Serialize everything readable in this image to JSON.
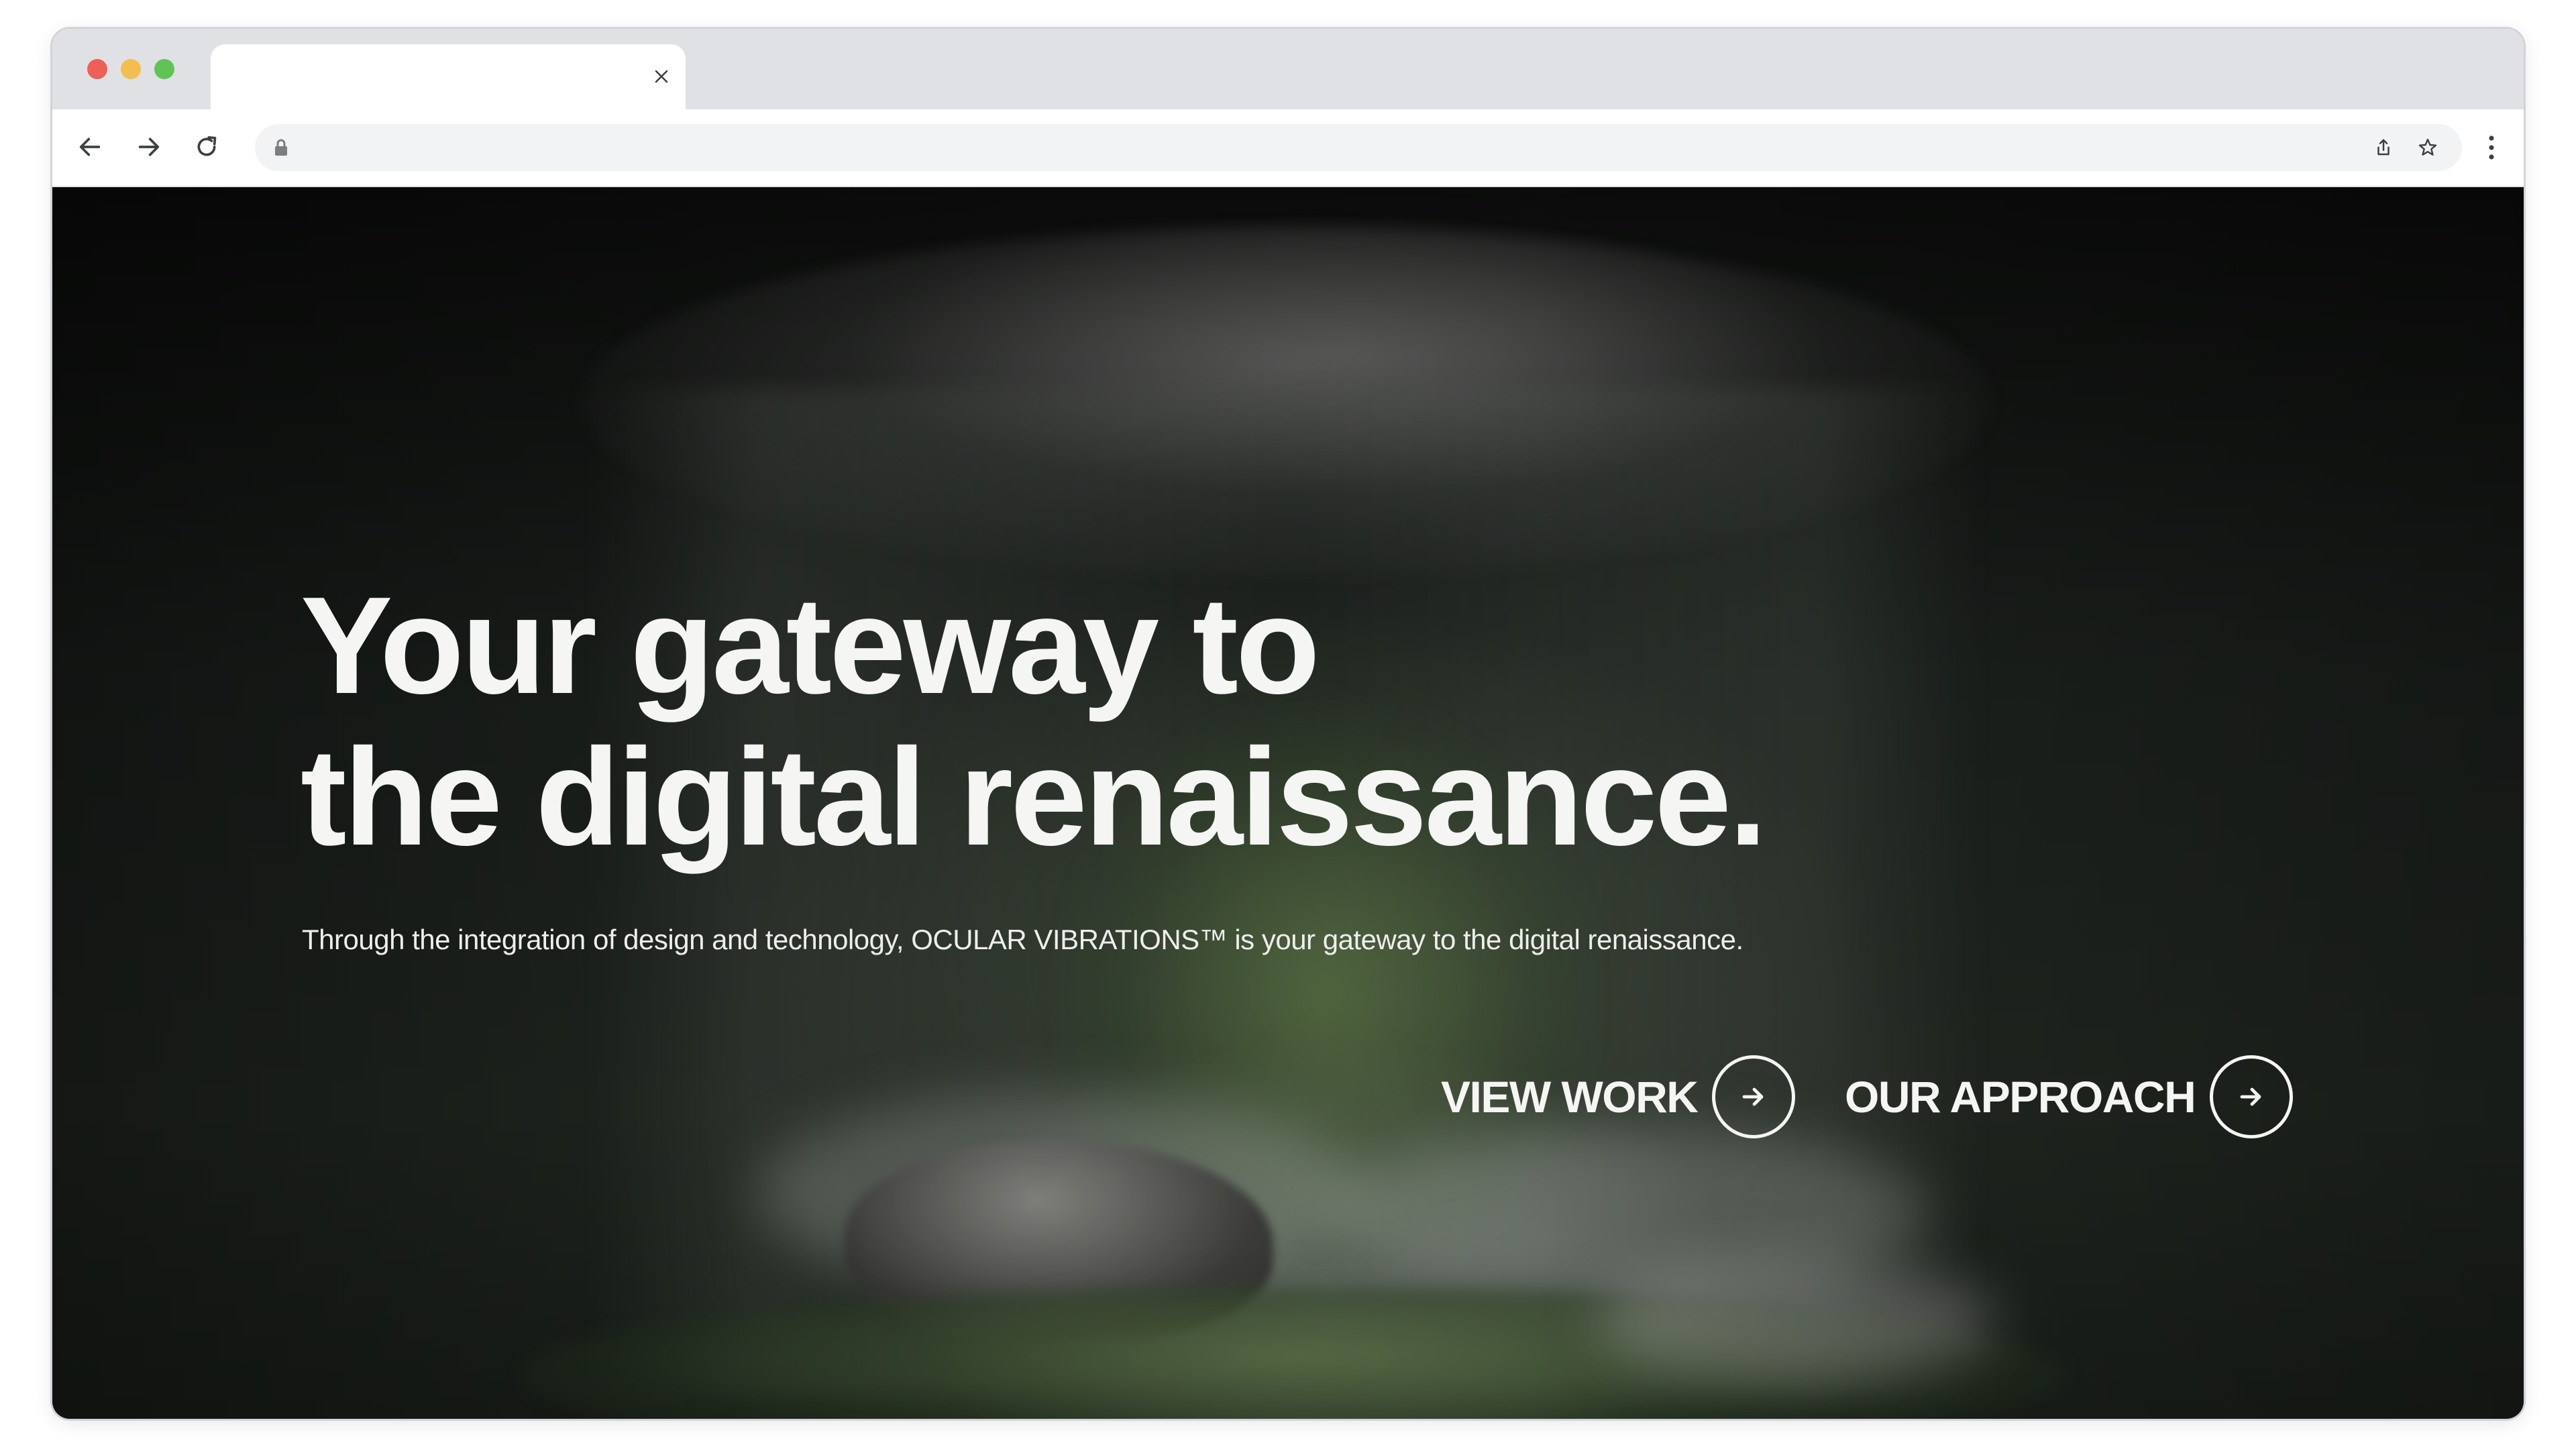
{
  "browser": {
    "tab": {
      "title": "",
      "close_icon": "close-icon"
    },
    "toolbar": {
      "back_icon": "arrow-left-icon",
      "forward_icon": "arrow-right-icon",
      "reload_icon": "reload-icon",
      "address": {
        "lock_icon": "lock-icon",
        "url": ""
      },
      "share_icon": "share-icon",
      "bookmark_icon": "star-icon",
      "menu_icon": "kebab-menu-icon"
    },
    "window_controls": {
      "close_color": "#ee5f57",
      "minimize_color": "#f4bd4f",
      "maximize_color": "#5fc454"
    }
  },
  "hero": {
    "title_line1": "Your gateway to",
    "title_line2": "the digital renaissance.",
    "subtitle": "Through the integration of design and technology, OCULAR VIBRATIONS™ is your gateway to the digital renaissance.",
    "ctas": [
      {
        "label": "VIEW WORK",
        "icon": "arrow-right-icon"
      },
      {
        "label": "OUR APPROACH",
        "icon": "arrow-right-icon"
      }
    ]
  },
  "colors": {
    "hero_text": "#f5f5f3",
    "tabbar_bg": "#dfe1e5",
    "omnibox_bg": "#f1f3f4"
  }
}
